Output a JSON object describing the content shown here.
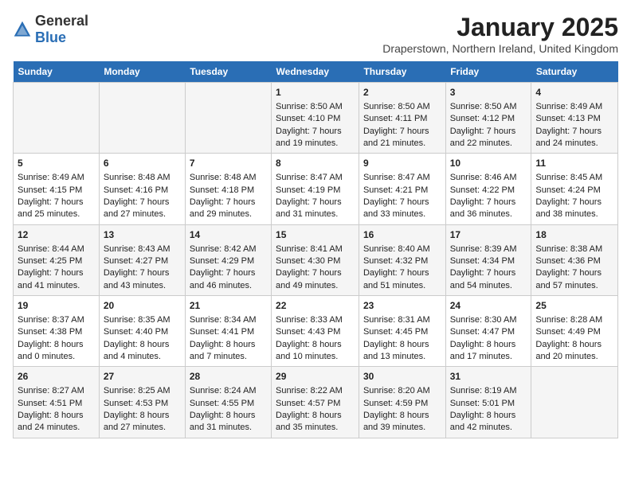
{
  "header": {
    "logo_general": "General",
    "logo_blue": "Blue",
    "month_title": "January 2025",
    "location": "Draperstown, Northern Ireland, United Kingdom"
  },
  "days_of_week": [
    "Sunday",
    "Monday",
    "Tuesday",
    "Wednesday",
    "Thursday",
    "Friday",
    "Saturday"
  ],
  "weeks": [
    [
      {
        "day": "",
        "content": ""
      },
      {
        "day": "",
        "content": ""
      },
      {
        "day": "",
        "content": ""
      },
      {
        "day": "1",
        "content": "Sunrise: 8:50 AM\nSunset: 4:10 PM\nDaylight: 7 hours\nand 19 minutes."
      },
      {
        "day": "2",
        "content": "Sunrise: 8:50 AM\nSunset: 4:11 PM\nDaylight: 7 hours\nand 21 minutes."
      },
      {
        "day": "3",
        "content": "Sunrise: 8:50 AM\nSunset: 4:12 PM\nDaylight: 7 hours\nand 22 minutes."
      },
      {
        "day": "4",
        "content": "Sunrise: 8:49 AM\nSunset: 4:13 PM\nDaylight: 7 hours\nand 24 minutes."
      }
    ],
    [
      {
        "day": "5",
        "content": "Sunrise: 8:49 AM\nSunset: 4:15 PM\nDaylight: 7 hours\nand 25 minutes."
      },
      {
        "day": "6",
        "content": "Sunrise: 8:48 AM\nSunset: 4:16 PM\nDaylight: 7 hours\nand 27 minutes."
      },
      {
        "day": "7",
        "content": "Sunrise: 8:48 AM\nSunset: 4:18 PM\nDaylight: 7 hours\nand 29 minutes."
      },
      {
        "day": "8",
        "content": "Sunrise: 8:47 AM\nSunset: 4:19 PM\nDaylight: 7 hours\nand 31 minutes."
      },
      {
        "day": "9",
        "content": "Sunrise: 8:47 AM\nSunset: 4:21 PM\nDaylight: 7 hours\nand 33 minutes."
      },
      {
        "day": "10",
        "content": "Sunrise: 8:46 AM\nSunset: 4:22 PM\nDaylight: 7 hours\nand 36 minutes."
      },
      {
        "day": "11",
        "content": "Sunrise: 8:45 AM\nSunset: 4:24 PM\nDaylight: 7 hours\nand 38 minutes."
      }
    ],
    [
      {
        "day": "12",
        "content": "Sunrise: 8:44 AM\nSunset: 4:25 PM\nDaylight: 7 hours\nand 41 minutes."
      },
      {
        "day": "13",
        "content": "Sunrise: 8:43 AM\nSunset: 4:27 PM\nDaylight: 7 hours\nand 43 minutes."
      },
      {
        "day": "14",
        "content": "Sunrise: 8:42 AM\nSunset: 4:29 PM\nDaylight: 7 hours\nand 46 minutes."
      },
      {
        "day": "15",
        "content": "Sunrise: 8:41 AM\nSunset: 4:30 PM\nDaylight: 7 hours\nand 49 minutes."
      },
      {
        "day": "16",
        "content": "Sunrise: 8:40 AM\nSunset: 4:32 PM\nDaylight: 7 hours\nand 51 minutes."
      },
      {
        "day": "17",
        "content": "Sunrise: 8:39 AM\nSunset: 4:34 PM\nDaylight: 7 hours\nand 54 minutes."
      },
      {
        "day": "18",
        "content": "Sunrise: 8:38 AM\nSunset: 4:36 PM\nDaylight: 7 hours\nand 57 minutes."
      }
    ],
    [
      {
        "day": "19",
        "content": "Sunrise: 8:37 AM\nSunset: 4:38 PM\nDaylight: 8 hours\nand 0 minutes."
      },
      {
        "day": "20",
        "content": "Sunrise: 8:35 AM\nSunset: 4:40 PM\nDaylight: 8 hours\nand 4 minutes."
      },
      {
        "day": "21",
        "content": "Sunrise: 8:34 AM\nSunset: 4:41 PM\nDaylight: 8 hours\nand 7 minutes."
      },
      {
        "day": "22",
        "content": "Sunrise: 8:33 AM\nSunset: 4:43 PM\nDaylight: 8 hours\nand 10 minutes."
      },
      {
        "day": "23",
        "content": "Sunrise: 8:31 AM\nSunset: 4:45 PM\nDaylight: 8 hours\nand 13 minutes."
      },
      {
        "day": "24",
        "content": "Sunrise: 8:30 AM\nSunset: 4:47 PM\nDaylight: 8 hours\nand 17 minutes."
      },
      {
        "day": "25",
        "content": "Sunrise: 8:28 AM\nSunset: 4:49 PM\nDaylight: 8 hours\nand 20 minutes."
      }
    ],
    [
      {
        "day": "26",
        "content": "Sunrise: 8:27 AM\nSunset: 4:51 PM\nDaylight: 8 hours\nand 24 minutes."
      },
      {
        "day": "27",
        "content": "Sunrise: 8:25 AM\nSunset: 4:53 PM\nDaylight: 8 hours\nand 27 minutes."
      },
      {
        "day": "28",
        "content": "Sunrise: 8:24 AM\nSunset: 4:55 PM\nDaylight: 8 hours\nand 31 minutes."
      },
      {
        "day": "29",
        "content": "Sunrise: 8:22 AM\nSunset: 4:57 PM\nDaylight: 8 hours\nand 35 minutes."
      },
      {
        "day": "30",
        "content": "Sunrise: 8:20 AM\nSunset: 4:59 PM\nDaylight: 8 hours\nand 39 minutes."
      },
      {
        "day": "31",
        "content": "Sunrise: 8:19 AM\nSunset: 5:01 PM\nDaylight: 8 hours\nand 42 minutes."
      },
      {
        "day": "",
        "content": ""
      }
    ]
  ]
}
